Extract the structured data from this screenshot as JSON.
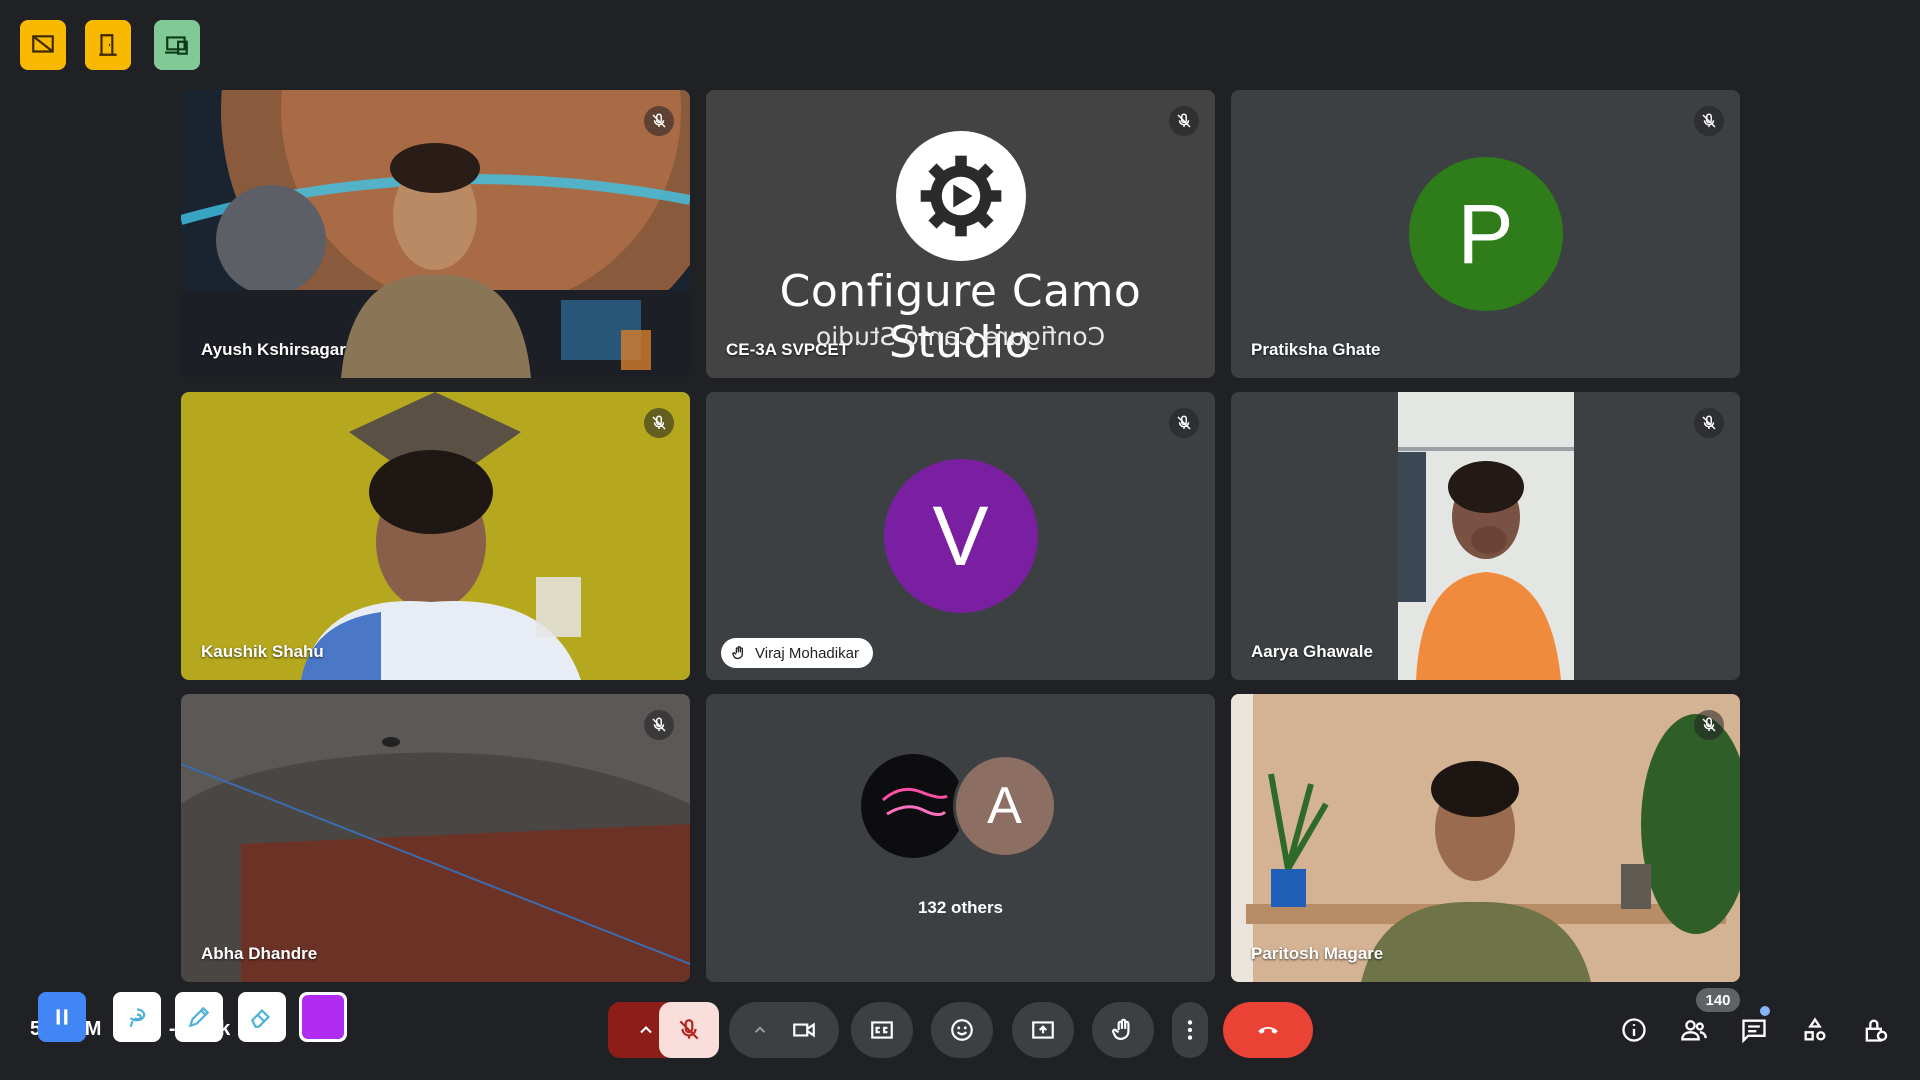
{
  "colors": {
    "background": "#202124",
    "tile": "#3c4043",
    "accent_red": "#ea4335",
    "pratiksha_avatar": "#2e7d1a",
    "viraj_avatar": "#7b1fa2",
    "others_avatar": "#8d6e63"
  },
  "top_toolbar": {
    "icons": [
      "hide-tiles-icon",
      "exit-door-icon",
      "devices-icon"
    ]
  },
  "participants": [
    {
      "name": "Ayush Kshirsagar",
      "type": "video",
      "muted": true
    },
    {
      "name": "CE-3A SVPCET",
      "type": "camo",
      "muted": true,
      "overlay_title": "Configure Camo Studio",
      "overlay_mirror": "Configure Camo Studio"
    },
    {
      "name": "Pratiksha Ghate",
      "type": "avatar",
      "initial": "P",
      "muted": true
    },
    {
      "name": "Kaushik Shahu",
      "type": "video",
      "muted": true
    },
    {
      "name": "Viraj Mohadikar",
      "type": "avatar",
      "initial": "V",
      "muted": true,
      "hand_raised": true
    },
    {
      "name": "Aarya Ghawale",
      "type": "video",
      "muted": true
    },
    {
      "name": "Abha Dhandre",
      "type": "video",
      "muted": true
    },
    {
      "name": "132 others",
      "type": "group",
      "initial": "A"
    },
    {
      "name": "Paritosh Magare",
      "type": "video",
      "muted": true
    }
  ],
  "bottom_left": {
    "time_partial": "5",
    "meeting_partial": "M",
    "partial_text": "-",
    "partial_text2": "k",
    "tools": [
      "pause-icon",
      "lasso-icon",
      "pen-icon",
      "eraser-icon",
      "color-swatch"
    ]
  },
  "controls": [
    "more-options-arrow-icon",
    "microphone-off-icon",
    "camera-options-arrow-icon",
    "camera-icon",
    "captions-icon",
    "emoji-icon",
    "present-screen-icon",
    "raise-hand-icon",
    "more-vert-icon",
    "end-call-icon"
  ],
  "right_panel": {
    "participant_count": "140",
    "icons": [
      "info-icon",
      "people-icon",
      "chat-icon",
      "activities-icon",
      "host-controls-icon"
    ]
  }
}
